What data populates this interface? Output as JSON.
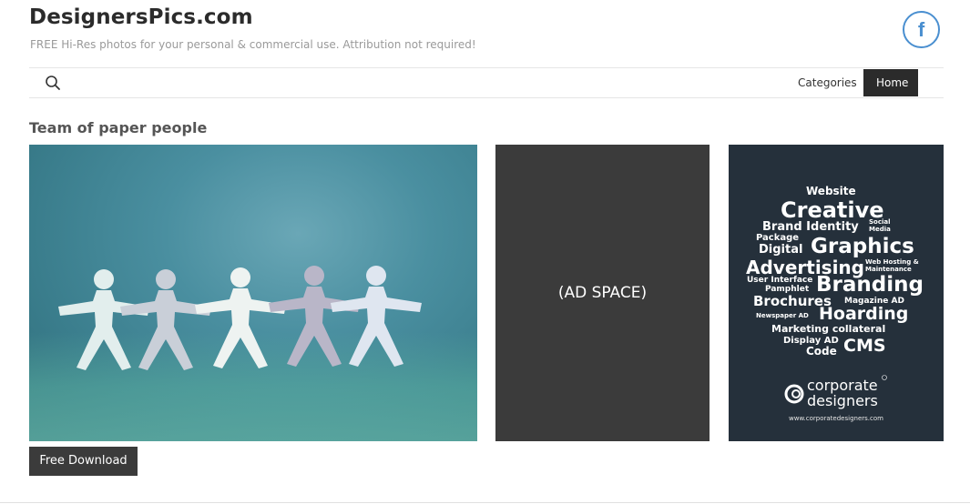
{
  "site": {
    "title": "DesignersPics.com",
    "tagline": "FREE Hi-Res photos for your personal & commercial use. Attribution not required!",
    "facebook_glyph": "f"
  },
  "nav": {
    "search_icon": "search-icon",
    "items": [
      {
        "label": "Categories",
        "active": false
      },
      {
        "label": "Home",
        "active": true
      }
    ]
  },
  "post": {
    "title": "Team of paper people",
    "download_label": "Free Download"
  },
  "ads": {
    "placeholder_label": "(AD SPACE)",
    "corporate": {
      "words": [
        "Website",
        "Creative",
        "Brand Identity",
        "Social",
        "Media",
        "Package",
        "Digital",
        "Graphics",
        "Advertising",
        "Web Hosting &",
        "Maintenance",
        "User Interface",
        "Pamphlet",
        "Branding",
        "Brochures",
        "Magazine AD",
        "Newspaper AD",
        "Hoarding",
        "Marketing collateral",
        "Display AD",
        "Code",
        "CMS"
      ],
      "logo_text": "corporate designers",
      "url": "www.corporatedesigners.com"
    }
  },
  "colors": {
    "accent_dark": "#2b2b2b",
    "facebook": "#4a8fd0",
    "ad_bg": "#3b3b3b",
    "corporate_bg": "#25303b"
  }
}
